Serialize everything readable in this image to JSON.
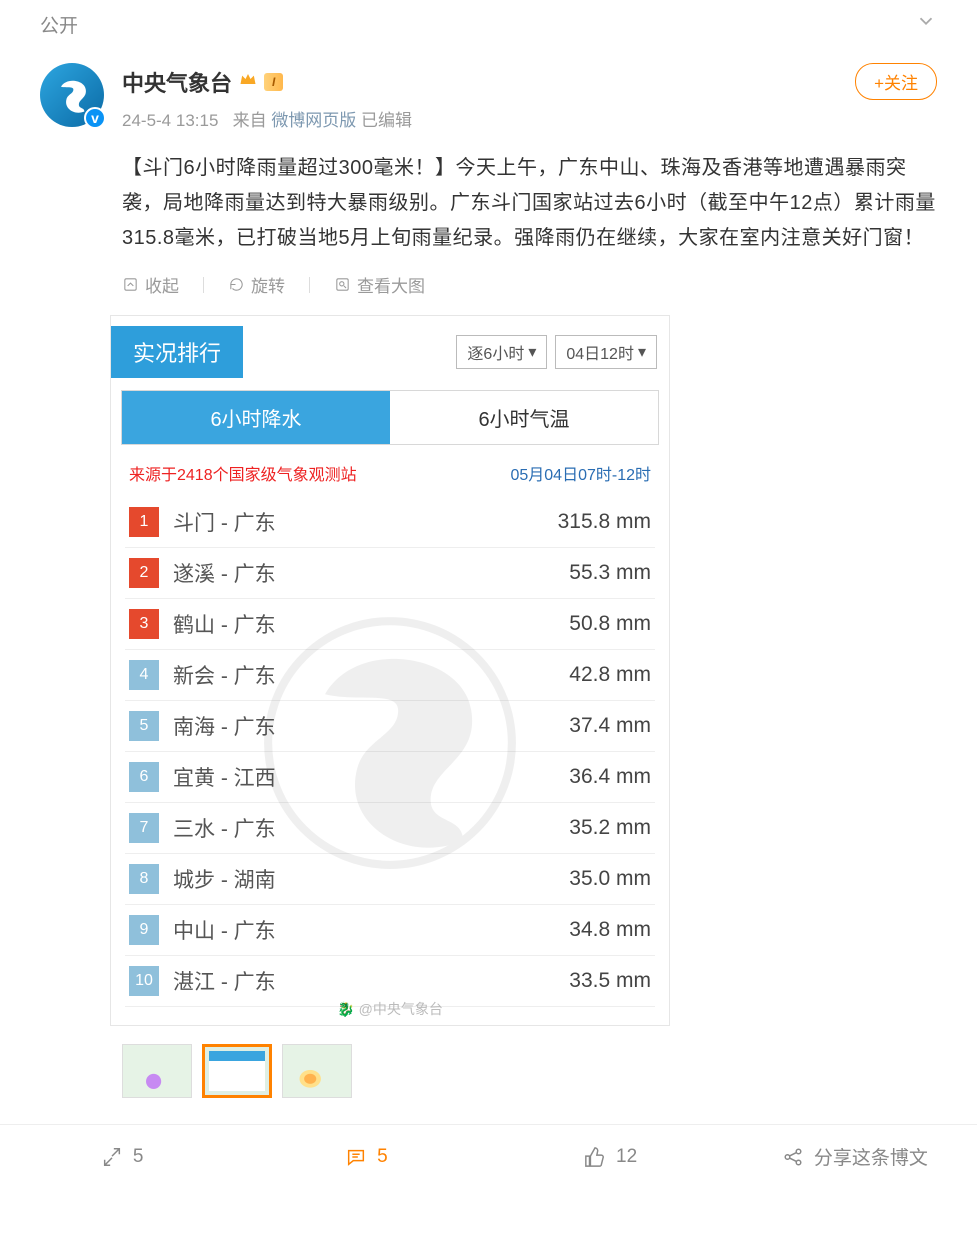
{
  "header": {
    "visibility": "公开"
  },
  "author": {
    "name": "中央气象台",
    "level": "I",
    "follow_label": "+关注"
  },
  "meta": {
    "time": "24-5-4 13:15",
    "from_prefix": "来自",
    "source": "微博网页版",
    "edited": "已编辑"
  },
  "content": "【斗门6小时降雨量超过300毫米！】今天上午，广东中山、珠海及香港等地遭遇暴雨突袭，局地降雨量达到特大暴雨级别。广东斗门国家站过去6小时（截至中午12点）累计雨量315.8毫米，已打破当地5月上旬雨量纪录。强降雨仍在继续，大家在室内注意关好门窗！",
  "image_actions": {
    "collapse": "收起",
    "rotate": "旋转",
    "view": "查看大图"
  },
  "embed": {
    "title_tab": "实况排行",
    "select_period": "逐6小时",
    "select_time": "04日12时",
    "mode_active": "6小时降水",
    "mode_other": "6小时气温",
    "source_text": "来源于2418个国家级气象观测站",
    "time_range": "05月04日07时-12时",
    "rows": [
      {
        "rank": "1",
        "name": "斗门 - 广东",
        "value": "315.8 mm"
      },
      {
        "rank": "2",
        "name": "遂溪 - 广东",
        "value": "55.3 mm"
      },
      {
        "rank": "3",
        "name": "鹤山 - 广东",
        "value": "50.8 mm"
      },
      {
        "rank": "4",
        "name": "新会 - 广东",
        "value": "42.8 mm"
      },
      {
        "rank": "5",
        "name": "南海 - 广东",
        "value": "37.4 mm"
      },
      {
        "rank": "6",
        "name": "宜黄 - 江西",
        "value": "36.4 mm"
      },
      {
        "rank": "7",
        "name": "三水 - 广东",
        "value": "35.2 mm"
      },
      {
        "rank": "8",
        "name": "城步 - 湖南",
        "value": "35.0 mm"
      },
      {
        "rank": "9",
        "name": "中山 - 广东",
        "value": "34.8 mm"
      },
      {
        "rank": "10",
        "name": "湛江 - 广东",
        "value": "33.5 mm"
      }
    ],
    "watermark_text": "@中央气象台"
  },
  "chart_data": {
    "type": "table",
    "title": "实况排行 6小时降水",
    "time_range": "05月04日07时-12时",
    "columns": [
      "rank",
      "station",
      "province",
      "precip_mm_6h"
    ],
    "rows": [
      [
        1,
        "斗门",
        "广东",
        315.8
      ],
      [
        2,
        "遂溪",
        "广东",
        55.3
      ],
      [
        3,
        "鹤山",
        "广东",
        50.8
      ],
      [
        4,
        "新会",
        "广东",
        42.8
      ],
      [
        5,
        "南海",
        "广东",
        37.4
      ],
      [
        6,
        "宜黄",
        "江西",
        36.4
      ],
      [
        7,
        "三水",
        "广东",
        35.2
      ],
      [
        8,
        "城步",
        "湖南",
        35.0
      ],
      [
        9,
        "中山",
        "广东",
        34.8
      ],
      [
        10,
        "湛江",
        "广东",
        33.5
      ]
    ]
  },
  "footer": {
    "repost_count": "5",
    "comment_count": "5",
    "like_count": "12",
    "share_label": "分享这条博文"
  }
}
